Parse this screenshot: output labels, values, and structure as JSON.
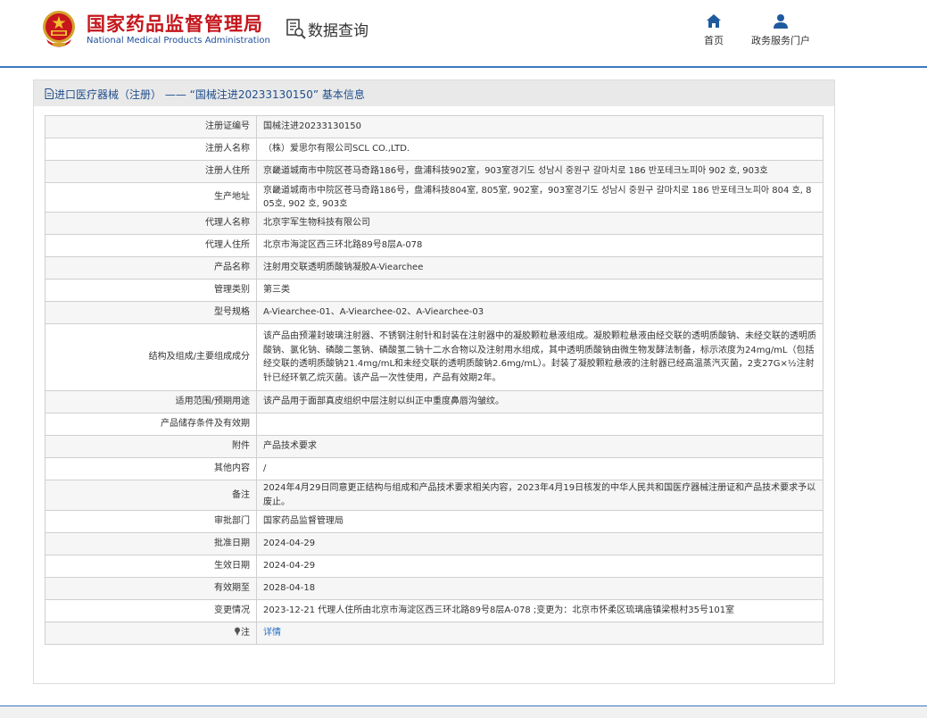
{
  "header": {
    "logo_cn": "国家药品监督管理局",
    "logo_en": "National Medical Products Administration",
    "query_title": "数据查询",
    "nav": [
      {
        "label": "首页",
        "icon": "home-icon"
      },
      {
        "label": "政务服务门户",
        "icon": "user-icon"
      }
    ]
  },
  "panel": {
    "title": "进口医疗器械（注册） —— “国械注进20233130150” 基本信息",
    "rows": [
      {
        "label": "注册证编号",
        "value": "国械注进20233130150"
      },
      {
        "label": "注册人名称",
        "value": " （株）爱思尔有限公司SCL CO.,LTD."
      },
      {
        "label": "注册人住所",
        "value": "京畿道城南市中院区苍马奇路186号，盘浦科技902室，903室경기도 성남시 중원구 갈마치로 186 반포테크노피아 902 호, 903호"
      },
      {
        "label": "生产地址",
        "value": "京畿道城南市中院区苍马奇路186号，盘浦科技804室, 805室, 902室，903室경기도 성남시 중원구 갈마치로 186 반포테크노피아 804 호, 805호, 902 호, 903호"
      },
      {
        "label": "代理人名称",
        "value": "北京宇军生物科技有限公司"
      },
      {
        "label": "代理人住所",
        "value": "北京市海淀区西三环北路89号8层A-078"
      },
      {
        "label": "产品名称",
        "value": "注射用交联透明质酸钠凝胶A-Viearchee"
      },
      {
        "label": "管理类别",
        "value": "第三类"
      },
      {
        "label": "型号规格",
        "value": "A-Viearchee-01、A-Viearchee-02、A-Viearchee-03"
      },
      {
        "label": "结构及组成/主要组成成分",
        "value": "该产品由预灌封玻璃注射器、不锈钢注射针和封装在注射器中的凝胶颗粒悬液组成。凝胶颗粒悬液由经交联的透明质酸钠、未经交联的透明质酸钠、氯化钠、磷酸二氢钠、磷酸氢二钠十二水合物以及注射用水组成，其中透明质酸钠由微生物发酵法制备，标示浓度为24mg/mL（包括经交联的透明质酸钠21.4mg/mL和未经交联的透明质酸钠2.6mg/mL）。封装了凝胶颗粒悬液的注射器已经高温蒸汽灭菌，2支27G×½注射针已经环氧乙烷灭菌。该产品一次性使用，产品有效期2年。"
      },
      {
        "label": "适用范围/预期用途",
        "value": "该产品用于面部真皮组织中层注射以纠正中重度鼻唇沟皱纹。"
      },
      {
        "label": "产品储存条件及有效期",
        "value": ""
      },
      {
        "label": "附件",
        "value": "产品技术要求"
      },
      {
        "label": "其他内容",
        "value": "/"
      },
      {
        "label": "备注",
        "value": "2024年4月29日同意更正结构与组成和产品技术要求相关内容，2023年4月19日核发的中华人民共和国医疗器械注册证和产品技术要求予以废止。"
      },
      {
        "label": "审批部门",
        "value": "国家药品监督管理局"
      },
      {
        "label": "批准日期",
        "value": "2024-04-29"
      },
      {
        "label": "生效日期",
        "value": "2024-04-29"
      },
      {
        "label": "有效期至",
        "value": "2028-04-18"
      },
      {
        "label": "变更情况",
        "value": "2023-12-21 代理人住所由北京市海淀区西三环北路89号8层A-078 ;变更为：北京市怀柔区琉璃庙镇梁根村35号101室"
      }
    ],
    "note_row": {
      "label": "注",
      "link": "详情",
      "icon": "pin-icon"
    }
  },
  "colors": {
    "brand_red": "#c4161c",
    "brand_blue": "#1d4e9a",
    "link": "#1f6ec2",
    "rule_blue": "#3b7bbf"
  }
}
